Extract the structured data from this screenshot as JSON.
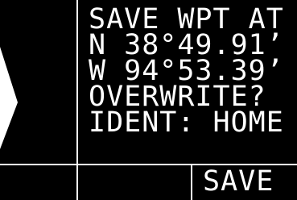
{
  "colors": {
    "screen_background": "#000000",
    "text": "#ffffff",
    "outside_bezel": "#ffffff"
  },
  "dialog": {
    "lines": [
      "SAVE WPT AT",
      "N 38°49.91’",
      "W 94°53.39’",
      "OVERWRITE?",
      "IDENT: HOME"
    ]
  },
  "softkeys": {
    "save_label": "SAVE"
  }
}
